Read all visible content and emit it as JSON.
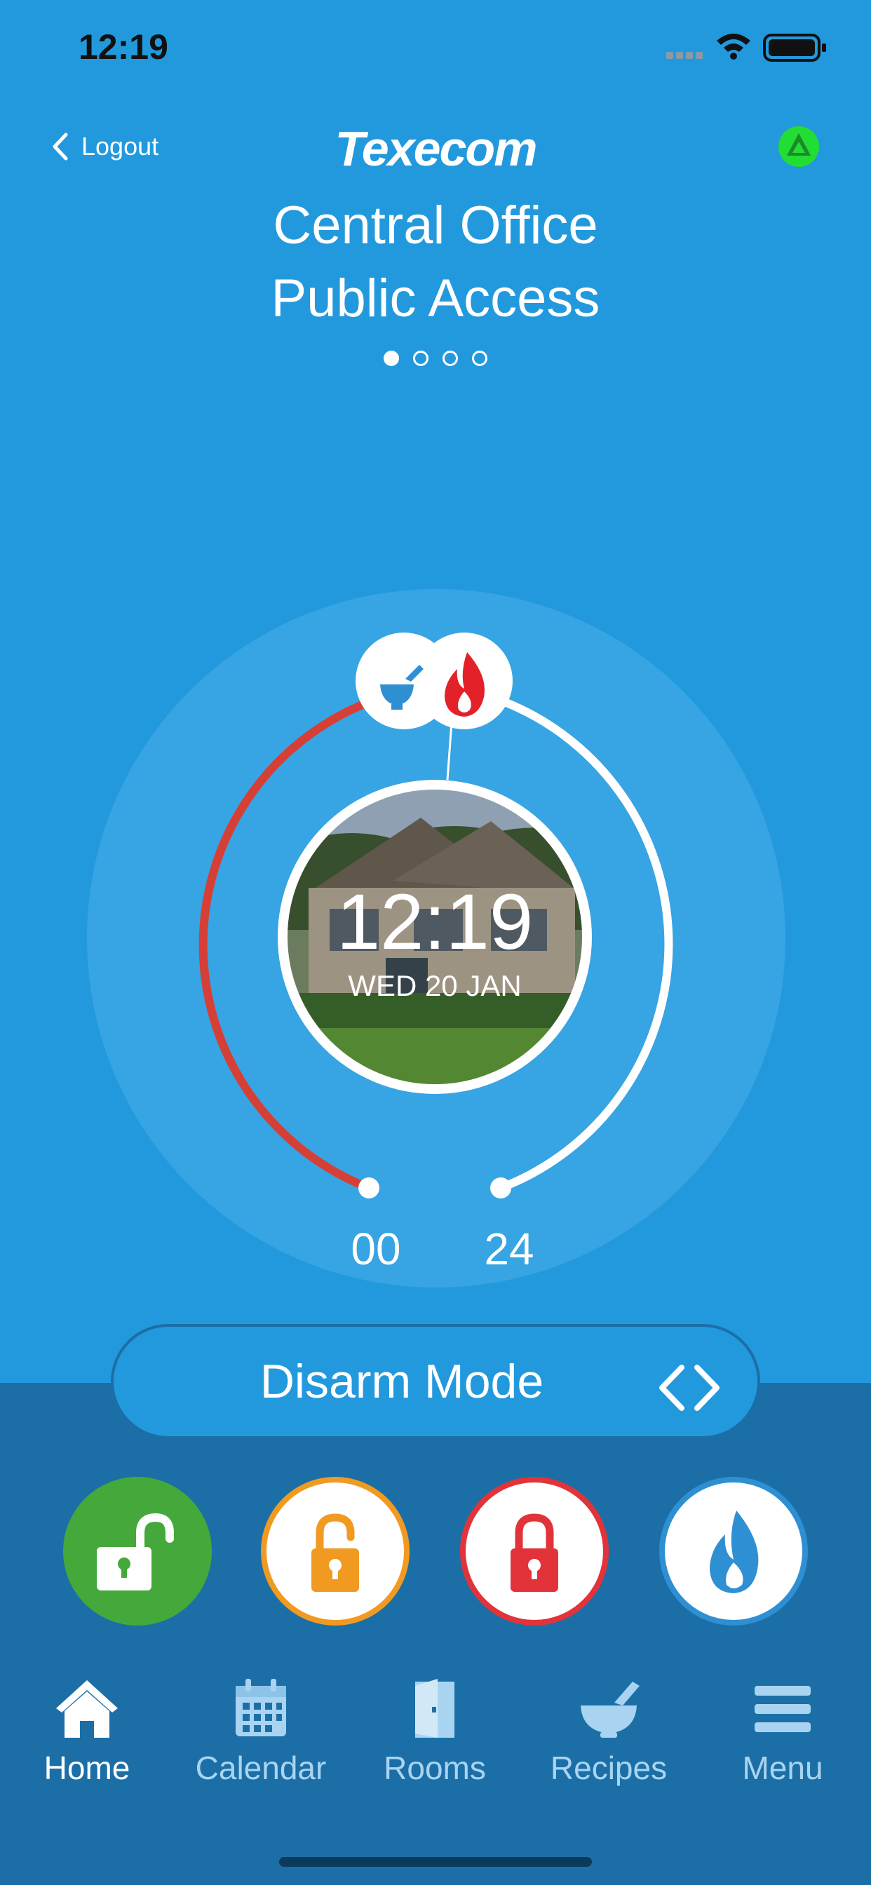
{
  "status_bar": {
    "time": "12:19"
  },
  "header": {
    "back_label": "Logout",
    "brand": "Texecom",
    "title_line1": "Central Office",
    "title_line2": "Public Access",
    "pager_count": 4,
    "pager_active": 0
  },
  "dial": {
    "time": "12:19",
    "date": "WED 20 JAN",
    "left_value": "00",
    "right_value": "24",
    "left_color": "#d63f36",
    "right_color": "#ffffff"
  },
  "mode": {
    "label": "Disarm Mode"
  },
  "actions": [
    {
      "name": "disarm",
      "color": "#44a93a"
    },
    {
      "name": "part-arm",
      "color": "#f19a22"
    },
    {
      "name": "full-arm",
      "color": "#e2333a"
    },
    {
      "name": "fire",
      "color": "#2f8fd3"
    }
  ],
  "tabs": [
    {
      "label": "Home",
      "icon": "home-icon",
      "active": true
    },
    {
      "label": "Calendar",
      "icon": "calendar-icon",
      "active": false
    },
    {
      "label": "Rooms",
      "icon": "door-icon",
      "active": false
    },
    {
      "label": "Recipes",
      "icon": "mortar-pestle-icon",
      "active": false
    },
    {
      "label": "Menu",
      "icon": "hamburger-icon",
      "active": false
    }
  ],
  "colors": {
    "background": "#2399dd",
    "lower_panel": "#1b6fa6",
    "connection_status": "#22dd33"
  }
}
